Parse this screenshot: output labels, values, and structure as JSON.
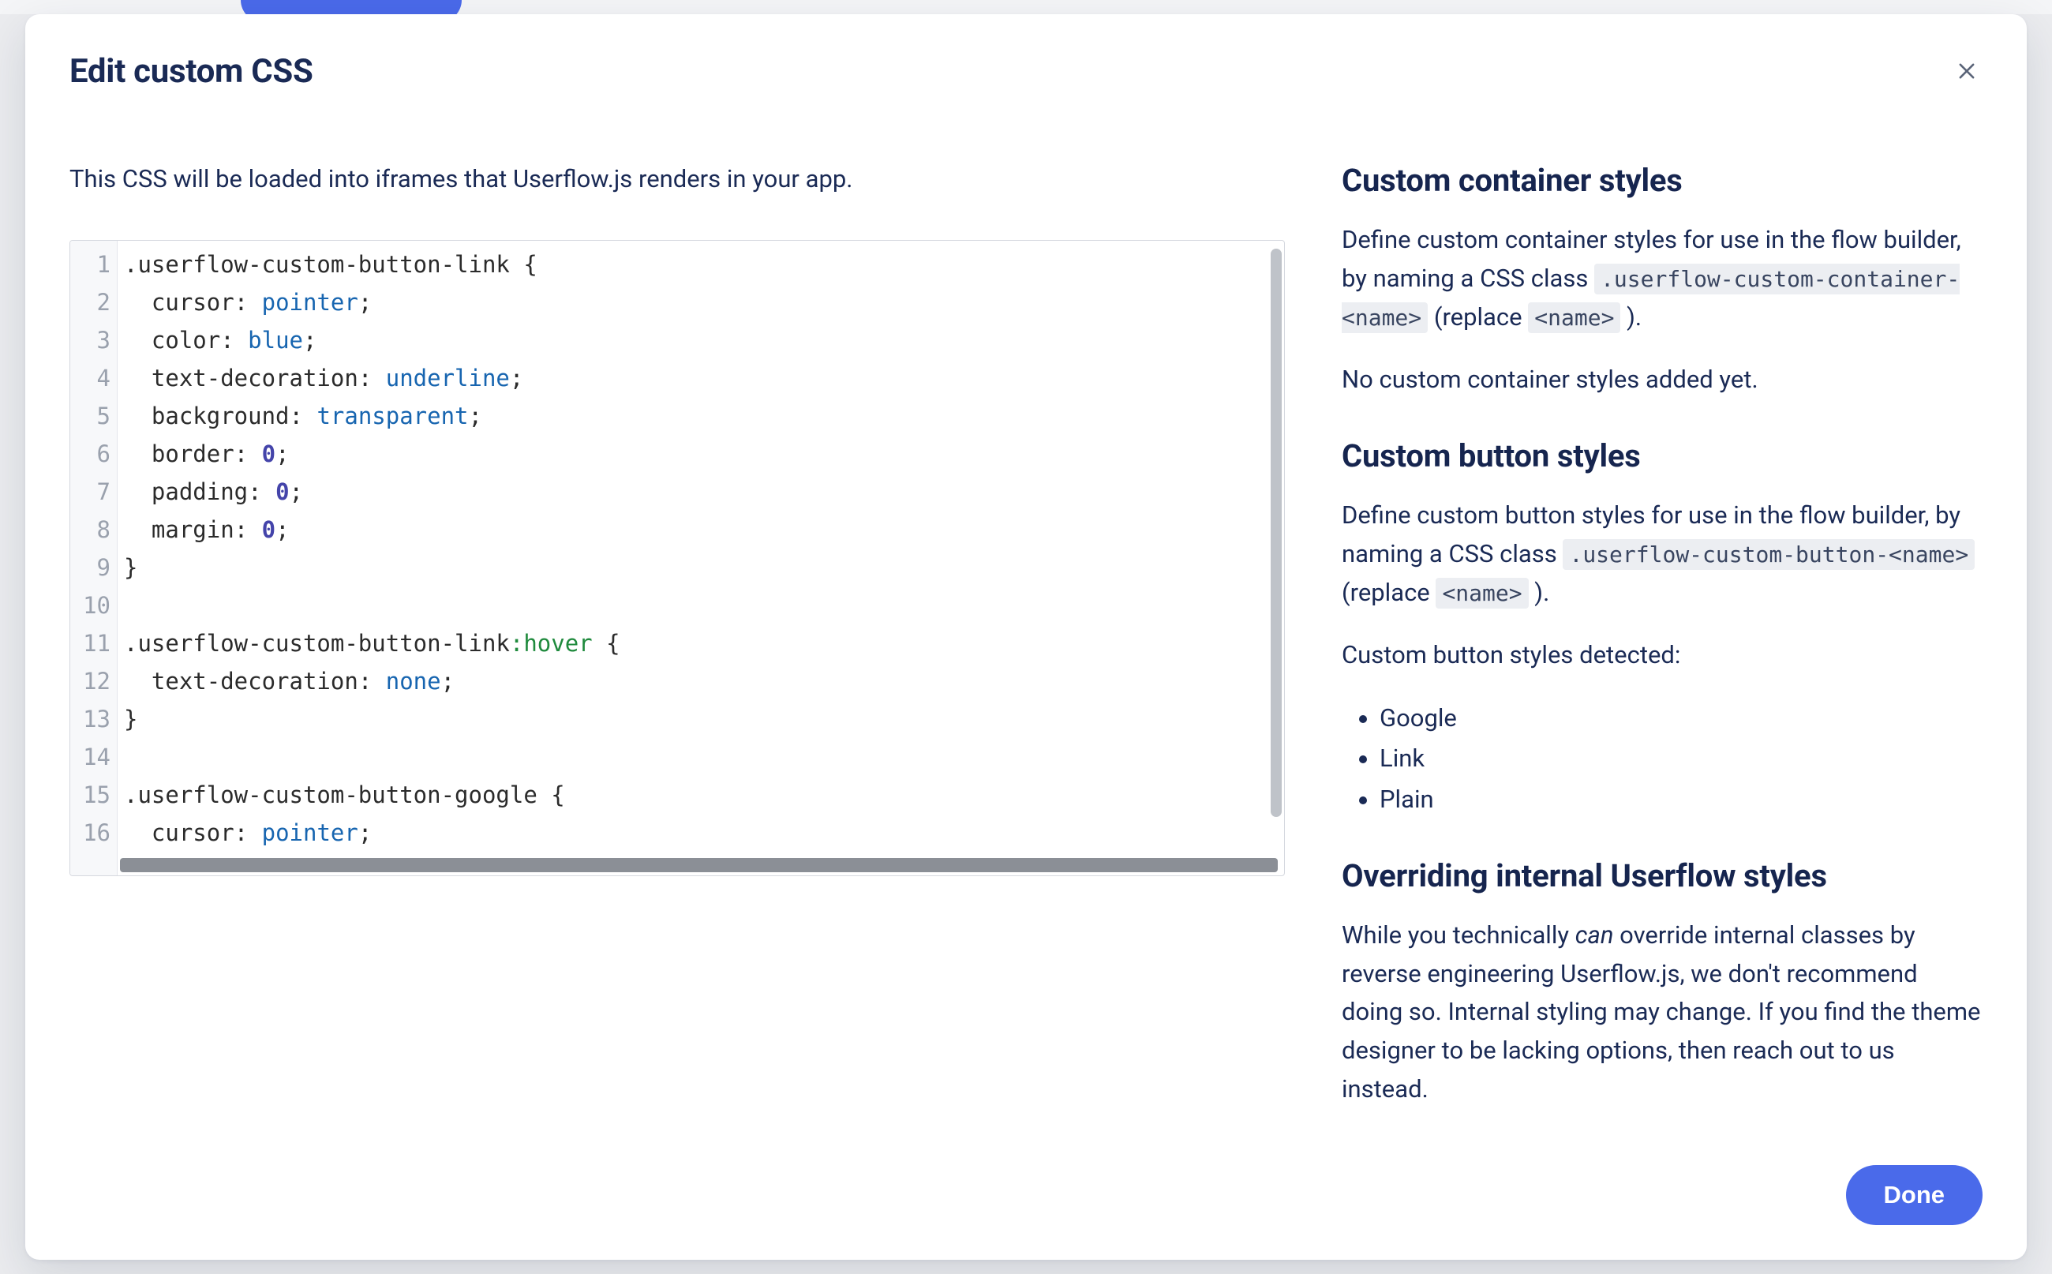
{
  "modal": {
    "title": "Edit custom CSS",
    "intro": "This CSS will be loaded into iframes that Userflow.js renders in your app.",
    "done_label": "Done"
  },
  "code": {
    "line_numbers": [
      "1",
      "2",
      "3",
      "4",
      "5",
      "6",
      "7",
      "8",
      "9",
      "10",
      "11",
      "12",
      "13",
      "14",
      "15",
      "16"
    ],
    "lines": [
      {
        "type": "selector",
        "tokens": [
          {
            "t": "sel",
            "v": ".userflow-custom-button-link "
          },
          {
            "t": "brace",
            "v": "{"
          }
        ]
      },
      {
        "type": "decl",
        "tokens": [
          {
            "t": "indent",
            "v": "  "
          },
          {
            "t": "prop",
            "v": "cursor"
          },
          {
            "t": "plain",
            "v": ": "
          },
          {
            "t": "val",
            "v": "pointer"
          },
          {
            "t": "plain",
            "v": ";"
          }
        ]
      },
      {
        "type": "decl",
        "tokens": [
          {
            "t": "indent",
            "v": "  "
          },
          {
            "t": "prop",
            "v": "color"
          },
          {
            "t": "plain",
            "v": ": "
          },
          {
            "t": "val",
            "v": "blue"
          },
          {
            "t": "plain",
            "v": ";"
          }
        ]
      },
      {
        "type": "decl",
        "tokens": [
          {
            "t": "indent",
            "v": "  "
          },
          {
            "t": "prop",
            "v": "text-decoration"
          },
          {
            "t": "plain",
            "v": ": "
          },
          {
            "t": "val",
            "v": "underline"
          },
          {
            "t": "plain",
            "v": ";"
          }
        ]
      },
      {
        "type": "decl",
        "tokens": [
          {
            "t": "indent",
            "v": "  "
          },
          {
            "t": "prop",
            "v": "background"
          },
          {
            "t": "plain",
            "v": ": "
          },
          {
            "t": "val",
            "v": "transparent"
          },
          {
            "t": "plain",
            "v": ";"
          }
        ]
      },
      {
        "type": "decl",
        "tokens": [
          {
            "t": "indent",
            "v": "  "
          },
          {
            "t": "prop",
            "v": "border"
          },
          {
            "t": "plain",
            "v": ": "
          },
          {
            "t": "num",
            "v": "0"
          },
          {
            "t": "plain",
            "v": ";"
          }
        ]
      },
      {
        "type": "decl",
        "tokens": [
          {
            "t": "indent",
            "v": "  "
          },
          {
            "t": "prop",
            "v": "padding"
          },
          {
            "t": "plain",
            "v": ": "
          },
          {
            "t": "num",
            "v": "0"
          },
          {
            "t": "plain",
            "v": ";"
          }
        ]
      },
      {
        "type": "decl",
        "tokens": [
          {
            "t": "indent",
            "v": "  "
          },
          {
            "t": "prop",
            "v": "margin"
          },
          {
            "t": "plain",
            "v": ": "
          },
          {
            "t": "num",
            "v": "0"
          },
          {
            "t": "plain",
            "v": ";"
          }
        ]
      },
      {
        "type": "brace",
        "tokens": [
          {
            "t": "brace",
            "v": "}"
          }
        ]
      },
      {
        "type": "blank",
        "tokens": []
      },
      {
        "type": "selector",
        "tokens": [
          {
            "t": "sel",
            "v": ".userflow-custom-button-link"
          },
          {
            "t": "pseudo",
            "v": ":hover"
          },
          {
            "t": "plain",
            "v": " "
          },
          {
            "t": "brace",
            "v": "{"
          }
        ]
      },
      {
        "type": "decl",
        "tokens": [
          {
            "t": "indent",
            "v": "  "
          },
          {
            "t": "prop",
            "v": "text-decoration"
          },
          {
            "t": "plain",
            "v": ": "
          },
          {
            "t": "val",
            "v": "none"
          },
          {
            "t": "plain",
            "v": ";"
          }
        ]
      },
      {
        "type": "brace",
        "tokens": [
          {
            "t": "brace",
            "v": "}"
          }
        ]
      },
      {
        "type": "blank",
        "tokens": []
      },
      {
        "type": "selector",
        "tokens": [
          {
            "t": "sel",
            "v": ".userflow-custom-button-google "
          },
          {
            "t": "brace",
            "v": "{"
          }
        ]
      },
      {
        "type": "decl",
        "tokens": [
          {
            "t": "indent",
            "v": "  "
          },
          {
            "t": "prop",
            "v": "cursor"
          },
          {
            "t": "plain",
            "v": ": "
          },
          {
            "t": "val",
            "v": "pointer"
          },
          {
            "t": "plain",
            "v": ";"
          }
        ]
      }
    ]
  },
  "sidebar": {
    "container": {
      "heading": "Custom container styles",
      "desc_pre": "Define custom container styles for use in the flow builder, by naming a CSS class ",
      "code1": ".userflow-custom-container-<name>",
      "desc_mid": " (replace ",
      "code2": "<name>",
      "desc_post": " ).",
      "empty": "No custom container styles added yet."
    },
    "button": {
      "heading": "Custom button styles",
      "desc_pre": "Define custom button styles for use in the flow builder, by naming a CSS class ",
      "code1": ".userflow-custom-button-<name>",
      "desc_mid": " (replace ",
      "code2": "<name>",
      "desc_post": " ).",
      "detected_label": "Custom button styles detected:",
      "detected": [
        "Google",
        "Link",
        "Plain"
      ]
    },
    "override": {
      "heading": "Overriding internal Userflow styles",
      "desc_pre": "While you technically ",
      "em": "can",
      "desc_post": " override internal classes by reverse engineering Userflow.js, we don't recommend doing so. Internal styling may change. If you find the theme designer to be lacking options, then reach out to us instead."
    }
  }
}
